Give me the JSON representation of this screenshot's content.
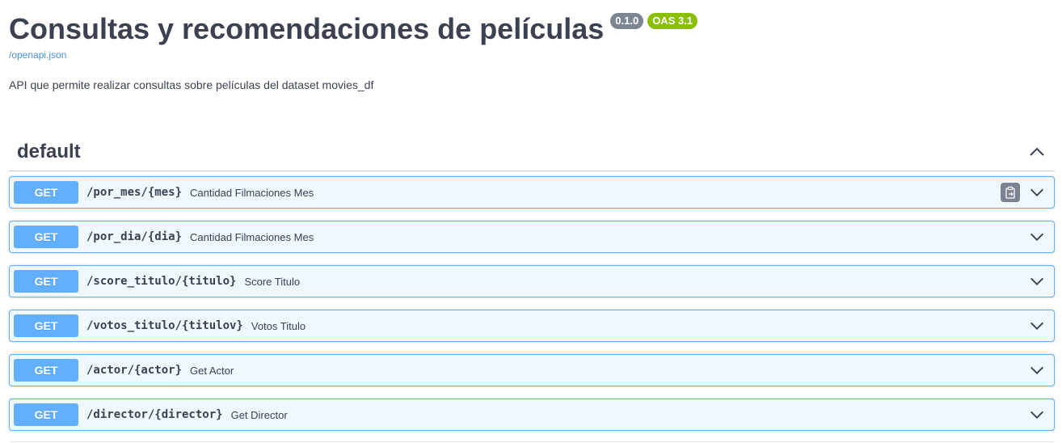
{
  "info": {
    "title": "Consultas y recomendaciones de películas",
    "version_badge": "0.1.0",
    "oas_badge": "OAS 3.1",
    "spec_link": "/openapi.json",
    "description": "API que permite realizar consultas sobre películas del dataset movies_df"
  },
  "section": {
    "title": "default",
    "toggle_icon": "chevron-up-icon"
  },
  "operations": [
    {
      "method": "GET",
      "path": "/por_mes/{mes}",
      "summary": "Cantidad Filmaciones Mes",
      "copy_icon": true
    },
    {
      "method": "GET",
      "path": "/por_dia/{dia}",
      "summary": "Cantidad Filmaciones Mes"
    },
    {
      "method": "GET",
      "path": "/score_titulo/{titulo}",
      "summary": "Score Titulo"
    },
    {
      "method": "GET",
      "path": "/votos_titulo/{titulov}",
      "summary": "Votos Titulo"
    },
    {
      "method": "GET",
      "path": "/actor/{actor}",
      "summary": "Get Actor"
    },
    {
      "method": "GET",
      "path": "/director/{director}",
      "summary": "Get Director"
    }
  ],
  "colors": {
    "get_accent": "#61affe",
    "version_badge": "#7d8492",
    "oas_badge": "#89bf04",
    "link": "#4990e2",
    "text": "#3b4151"
  }
}
